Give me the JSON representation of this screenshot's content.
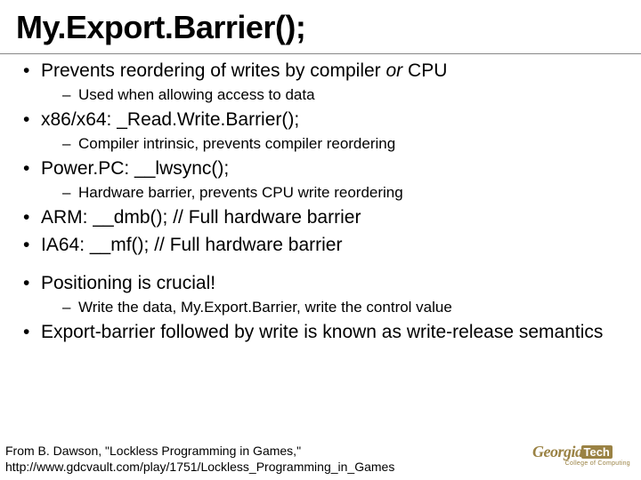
{
  "title": "My.Export.Barrier();",
  "bullets": {
    "b1": "Prevents reordering of writes by compiler ",
    "b1_em": "or",
    "b1_tail": " CPU",
    "b1_sub1": "Used when allowing access to data",
    "b2": "x86/x64: _Read.Write.Barrier();",
    "b2_sub1": "Compiler intrinsic, prevents compiler reordering",
    "b3": "Power.PC: __lwsync();",
    "b3_sub1": "Hardware barrier, prevents CPU write reordering",
    "b4": "ARM: __dmb(); // Full hardware barrier",
    "b5": "IA64: __mf(); // Full hardware barrier",
    "b6": "Positioning is crucial!",
    "b6_sub1": "Write the data, My.Export.Barrier, write the control value",
    "b7": "Export-barrier followed by write is known as write-release semantics"
  },
  "citation": {
    "line1": "From B. Dawson, \"Lockless Programming in Games,\"",
    "line2": "http://www.gdcvault.com/play/1751/Lockless_Programming_in_Games"
  },
  "logo": {
    "main": "Georgia",
    "tech": "Tech",
    "sub": "College of Computing"
  }
}
